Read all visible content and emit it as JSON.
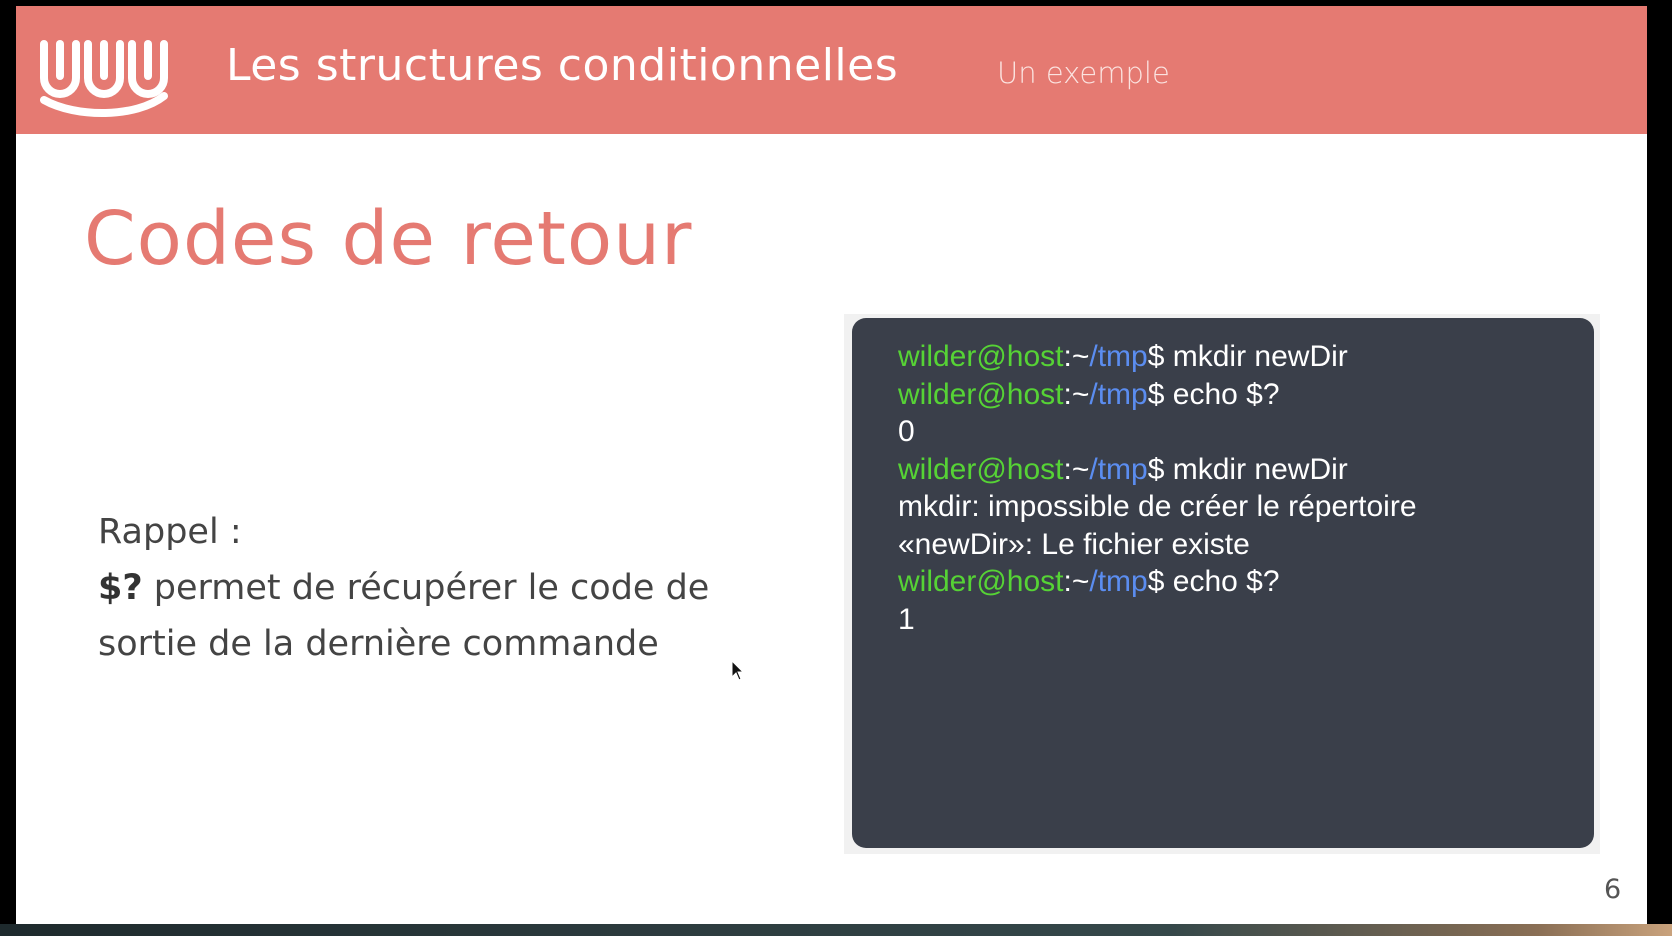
{
  "header": {
    "title": "Les structures conditionnelles",
    "subtitle": "Un exemple",
    "logo_icon": "wild-code-school-logo-icon",
    "background_color": "#e57a72"
  },
  "slide": {
    "title": "Codes de retour",
    "rappel_label": "Rappel :",
    "code_term": "$?",
    "explanation": " permet de récupérer le code de sortie de la dernière commande",
    "page_number": "6"
  },
  "terminal": {
    "background_color": "#3a3f4a",
    "user_color": "#56d335",
    "path_color": "#5b8df0",
    "lines": [
      {
        "user": "wilder@host",
        "sep": ":~",
        "path": "/tmp",
        "cmd": "$ mkdir newDir"
      },
      {
        "user": "wilder@host",
        "sep": ":~",
        "path": "/tmp",
        "cmd": "$ echo $?"
      },
      {
        "output": "0"
      },
      {
        "user": "wilder@host",
        "sep": ":~",
        "path": "/tmp",
        "cmd": "$ mkdir newDir"
      },
      {
        "output": "mkdir: impossible de créer le répertoire"
      },
      {
        "output": "«newDir»: Le fichier existe"
      },
      {
        "user": "wilder@host",
        "sep": ":~",
        "path": "/tmp",
        "cmd": "$ echo $?"
      },
      {
        "output": "1"
      }
    ]
  },
  "cursor_icon": "mouse-pointer-icon"
}
